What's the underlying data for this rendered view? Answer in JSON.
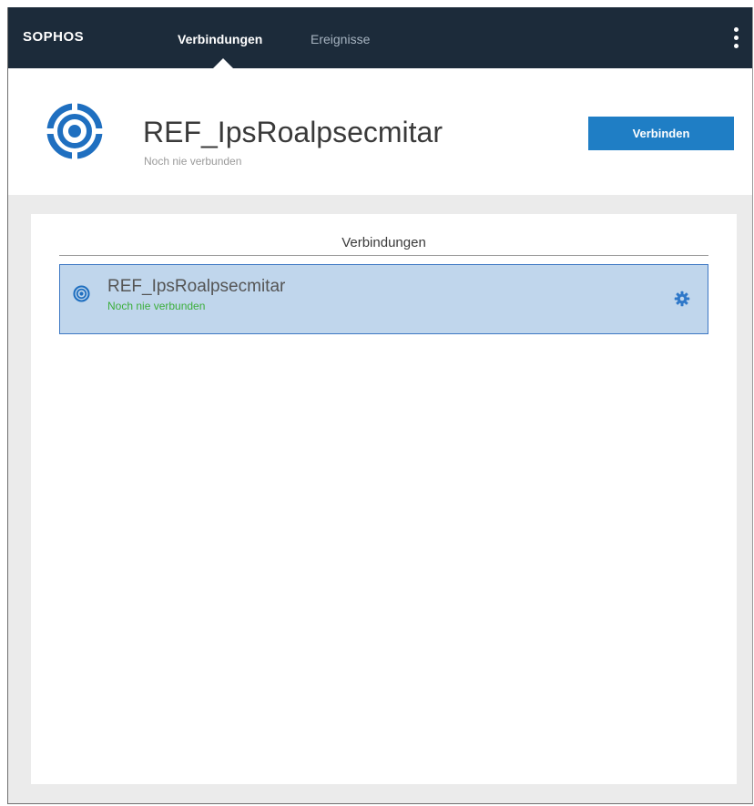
{
  "topbar": {
    "brand": "SOPHOS",
    "tabs": [
      {
        "label": "Verbindungen",
        "active": true
      },
      {
        "label": "Ereignisse",
        "active": false
      }
    ],
    "menu_icon": "kebab-menu-icon"
  },
  "header": {
    "icon": "connection-target-icon",
    "title": "REF_IpsRoalpsecmitar",
    "subtitle": "Noch nie verbunden",
    "connect_label": "Verbinden"
  },
  "connections": {
    "section_title": "Verbindungen",
    "items": [
      {
        "name": "REF_IpsRoalpsecmitar",
        "status": "Noch nie verbunden",
        "icon": "connection-target-icon",
        "settings_icon": "gear-icon"
      }
    ]
  },
  "colors": {
    "topbar_bg": "#1c2b3a",
    "accent_blue": "#1f7ec5",
    "selected_row_bg": "#c0d6ec",
    "status_green": "#3cae3c"
  }
}
